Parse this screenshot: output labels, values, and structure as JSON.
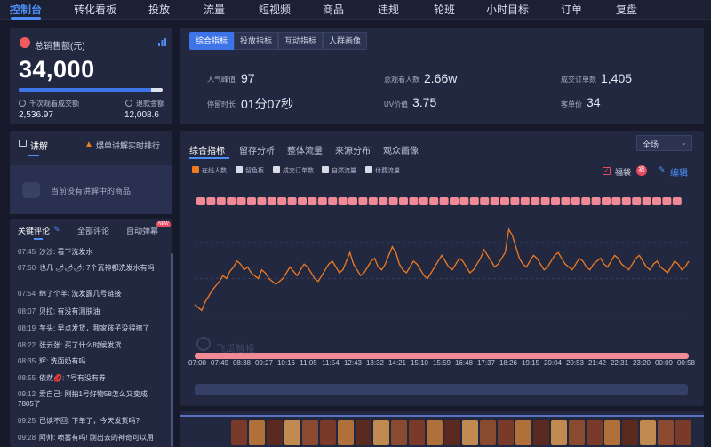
{
  "nav": [
    "控制台",
    "转化看板",
    "投放",
    "流量",
    "短视频",
    "商品",
    "违规",
    "轮班",
    "小时目标",
    "订单",
    "复盘"
  ],
  "sales": {
    "title": "总销售额(元)",
    "value": "34,000",
    "k_label": "千次观看成交额",
    "k_value": "2,536.97",
    "refund_label": "退款金额",
    "refund_value": "12,008.6",
    "progress": 0.92
  },
  "metric_tabs": [
    "综合指标",
    "投放指标",
    "互动指标",
    "人群画像"
  ],
  "metrics": [
    {
      "label": "人气峰值",
      "value": "97"
    },
    {
      "label": "总观看人数",
      "value": "2.66w"
    },
    {
      "label": "成交订单数",
      "value": "1,405"
    },
    {
      "label": "停留时长",
      "value": "01分07秒"
    },
    {
      "label": "UV价值",
      "value": "3.75"
    },
    {
      "label": "客单价",
      "value": "34"
    }
  ],
  "explain": {
    "title": "讲解",
    "rank_label": "爆单讲解实时排行",
    "empty": "当前没有讲解中的商品"
  },
  "comments_tabs": [
    "关键评论",
    "全部评论",
    "自动弹幕"
  ],
  "new_badge": "NEW",
  "comments": [
    {
      "time": "07:45",
      "text": "沙沙: 看下洗发水"
    },
    {
      "time": "07:50",
      "text": "也几 🌶🌶🌶: 7个瓦神都洗发水有吗"
    },
    {
      "time": "07:54",
      "text": "绵了个羊: 洗发露几号链接"
    },
    {
      "time": "08:07",
      "text": "贝拉: 有没有测肤油"
    },
    {
      "time": "08:19",
      "text": "芋头: 早点发货，我家孩子没得擦了"
    },
    {
      "time": "08:22",
      "text": "张云张: 买了什么时候发货"
    },
    {
      "time": "08:35",
      "text": "辉: 洗面奶有吗"
    },
    {
      "time": "08:55",
      "text": "依然💋: 7号有没有券"
    },
    {
      "time": "09:12",
      "text": "爱自己: 刚拍1号好物58怎么又变成7805了"
    },
    {
      "time": "09:25",
      "text": "已读不回: 下单了，今天发货吗?"
    },
    {
      "time": "09:28",
      "text": "阿帅: 喷雾有吗! 刚出去的神奇可以用"
    }
  ],
  "chart_tabs": [
    "综合指标",
    "留存分析",
    "整体流量",
    "来源分布",
    "观众画像"
  ],
  "select_value": "全场",
  "legend": [
    {
      "label": "在线人数",
      "on": true
    },
    {
      "label": "留色板",
      "on": false
    },
    {
      "label": "成交订单数",
      "on": false
    },
    {
      "label": "自然流量",
      "on": false
    },
    {
      "label": "付费流量",
      "on": false
    }
  ],
  "fudai_label": "福袋",
  "fudai_badge": "福",
  "edit_label": "编辑",
  "watermark": "飞瓜智投",
  "colors": {
    "accent": "#4d8df5",
    "line": "#f07a1f",
    "marker": "#f08a96",
    "bg": "#161a2b",
    "panel": "#222840"
  },
  "chart_data": {
    "type": "line",
    "xlabel": "",
    "ylabel": "",
    "x_ticks": [
      "07:00",
      "07:49",
      "08:38",
      "09:27",
      "10:16",
      "11:05",
      "11:54",
      "12:43",
      "13:32",
      "14:21",
      "15:10",
      "15:59",
      "16:48",
      "17:37",
      "18:26",
      "19:15",
      "20:04",
      "20:53",
      "21:42",
      "22:31",
      "23:20",
      "00:09",
      "00:58"
    ],
    "grid": true,
    "series": [
      {
        "name": "在线人数",
        "values": [
          32,
          30,
          28,
          34,
          38,
          42,
          45,
          48,
          52,
          50,
          55,
          58,
          62,
          60,
          56,
          58,
          54,
          52,
          50,
          56,
          54,
          50,
          48,
          46,
          48,
          50,
          54,
          58,
          55,
          52,
          56,
          60,
          58,
          54,
          50,
          48,
          52,
          56,
          60,
          62,
          58,
          54,
          56,
          62,
          68,
          60,
          56,
          52,
          54,
          58,
          62,
          64,
          58,
          56,
          60,
          66,
          72,
          68,
          60,
          56,
          54,
          58,
          62,
          60,
          56,
          52,
          50,
          54,
          58,
          62,
          66,
          62,
          58,
          56,
          60,
          64,
          62,
          58,
          54,
          56,
          60,
          64,
          70,
          66,
          62,
          58,
          60,
          64,
          68,
          84,
          80,
          72,
          64,
          60,
          58,
          62,
          66,
          64,
          60,
          56,
          58,
          62,
          66,
          68,
          64,
          60,
          58,
          56,
          60,
          64,
          62,
          58,
          56,
          60,
          62,
          64,
          60,
          58,
          62,
          66,
          64,
          60,
          58,
          56,
          60,
          64,
          66,
          62,
          58,
          56,
          60,
          62,
          58,
          56,
          54,
          58,
          62,
          60,
          56,
          58,
          62
        ]
      }
    ]
  }
}
